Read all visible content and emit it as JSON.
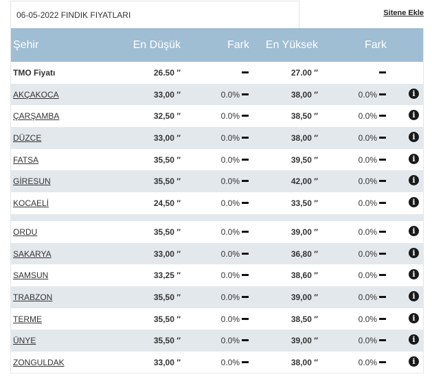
{
  "title": "06-05-2022 FINDIK FIYATLARI",
  "add_link": "Sitene Ekle",
  "headers": {
    "city": "Şehir",
    "low": "En Düşük",
    "fark1": "Fark",
    "high": "En Yüksek",
    "fark2": "Fark"
  },
  "tmo": {
    "city": "TMO Fiyatı",
    "low": "26.50 ″",
    "high": "27.00 ″"
  },
  "rows": [
    {
      "city": "AKÇAKOCA",
      "low": "33,00 ″",
      "fark1": "0.0%",
      "high": "38,00 ″",
      "fark2": "0.0%"
    },
    {
      "city": "ÇARŞAMBA",
      "low": "32,50 ″",
      "fark1": "0.0%",
      "high": "38,50 ″",
      "fark2": "0.0%"
    },
    {
      "city": "DÜZCE",
      "low": "33,00 ″",
      "fark1": "0.0%",
      "high": "38,00 ″",
      "fark2": "0.0%"
    },
    {
      "city": "FATSA",
      "low": "35,50 ″",
      "fark1": "0.0%",
      "high": "39,50 ″",
      "fark2": "0.0%"
    },
    {
      "city": "GİRESUN",
      "low": "35,50 ″",
      "fark1": "0.0%",
      "high": "42,00 ″",
      "fark2": "0.0%"
    },
    {
      "city": "KOCAELİ",
      "low": "24,50 ″",
      "fark1": "0.0%",
      "high": "33,50 ″",
      "fark2": "0.0%"
    },
    {
      "city": "ORDU",
      "low": "35,50 ″",
      "fark1": "0.0%",
      "high": "39,00 ″",
      "fark2": "0.0%"
    },
    {
      "city": "SAKARYA",
      "low": "33,00 ″",
      "fark1": "0.0%",
      "high": "36,80 ″",
      "fark2": "0.0%"
    },
    {
      "city": "SAMSUN",
      "low": "33,25 ″",
      "fark1": "0.0%",
      "high": "38,60 ″",
      "fark2": "0.0%"
    },
    {
      "city": "TRABZON",
      "low": "35,50 ″",
      "fark1": "0.0%",
      "high": "39,00 ″",
      "fark2": "0.0%"
    },
    {
      "city": "TERME",
      "low": "35,50 ″",
      "fark1": "0.0%",
      "high": "38,50 ″",
      "fark2": "0.0%"
    },
    {
      "city": "ÜNYE",
      "low": "35,50 ″",
      "fark1": "0.0%",
      "high": "39,00 ″",
      "fark2": "0.0%"
    },
    {
      "city": "ZONGULDAK",
      "low": "33,00 ″",
      "fark1": "0.0%",
      "high": "38,00 ″",
      "fark2": "0.0%"
    }
  ],
  "info_icon": "info-icon"
}
